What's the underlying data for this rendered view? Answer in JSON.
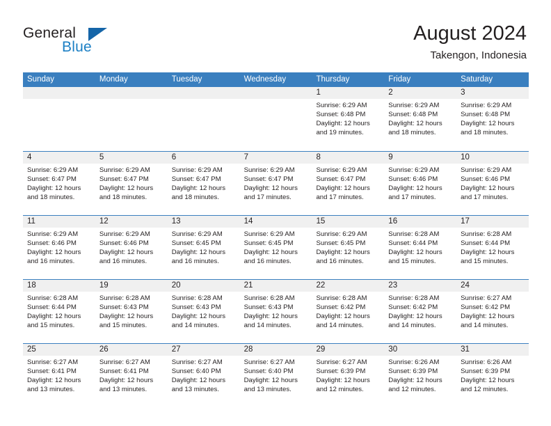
{
  "brand": {
    "name_part1": "General",
    "name_part2": "Blue",
    "triangle_color": "#1565a8",
    "accent_color": "#1b7fc4"
  },
  "header": {
    "title": "August 2024",
    "subtitle": "Takengon, Indonesia",
    "header_bg": "#3a7fbf",
    "date_bar_bg": "#f0f0f0"
  },
  "calendar": {
    "weekdays": [
      "Sunday",
      "Monday",
      "Tuesday",
      "Wednesday",
      "Thursday",
      "Friday",
      "Saturday"
    ],
    "weeks": [
      [
        {
          "day": "",
          "lines": []
        },
        {
          "day": "",
          "lines": []
        },
        {
          "day": "",
          "lines": []
        },
        {
          "day": "",
          "lines": []
        },
        {
          "day": "1",
          "lines": [
            "Sunrise: 6:29 AM",
            "Sunset: 6:48 PM",
            "Daylight: 12 hours",
            "and 19 minutes."
          ]
        },
        {
          "day": "2",
          "lines": [
            "Sunrise: 6:29 AM",
            "Sunset: 6:48 PM",
            "Daylight: 12 hours",
            "and 18 minutes."
          ]
        },
        {
          "day": "3",
          "lines": [
            "Sunrise: 6:29 AM",
            "Sunset: 6:48 PM",
            "Daylight: 12 hours",
            "and 18 minutes."
          ]
        }
      ],
      [
        {
          "day": "4",
          "lines": [
            "Sunrise: 6:29 AM",
            "Sunset: 6:47 PM",
            "Daylight: 12 hours",
            "and 18 minutes."
          ]
        },
        {
          "day": "5",
          "lines": [
            "Sunrise: 6:29 AM",
            "Sunset: 6:47 PM",
            "Daylight: 12 hours",
            "and 18 minutes."
          ]
        },
        {
          "day": "6",
          "lines": [
            "Sunrise: 6:29 AM",
            "Sunset: 6:47 PM",
            "Daylight: 12 hours",
            "and 18 minutes."
          ]
        },
        {
          "day": "7",
          "lines": [
            "Sunrise: 6:29 AM",
            "Sunset: 6:47 PM",
            "Daylight: 12 hours",
            "and 17 minutes."
          ]
        },
        {
          "day": "8",
          "lines": [
            "Sunrise: 6:29 AM",
            "Sunset: 6:47 PM",
            "Daylight: 12 hours",
            "and 17 minutes."
          ]
        },
        {
          "day": "9",
          "lines": [
            "Sunrise: 6:29 AM",
            "Sunset: 6:46 PM",
            "Daylight: 12 hours",
            "and 17 minutes."
          ]
        },
        {
          "day": "10",
          "lines": [
            "Sunrise: 6:29 AM",
            "Sunset: 6:46 PM",
            "Daylight: 12 hours",
            "and 17 minutes."
          ]
        }
      ],
      [
        {
          "day": "11",
          "lines": [
            "Sunrise: 6:29 AM",
            "Sunset: 6:46 PM",
            "Daylight: 12 hours",
            "and 16 minutes."
          ]
        },
        {
          "day": "12",
          "lines": [
            "Sunrise: 6:29 AM",
            "Sunset: 6:46 PM",
            "Daylight: 12 hours",
            "and 16 minutes."
          ]
        },
        {
          "day": "13",
          "lines": [
            "Sunrise: 6:29 AM",
            "Sunset: 6:45 PM",
            "Daylight: 12 hours",
            "and 16 minutes."
          ]
        },
        {
          "day": "14",
          "lines": [
            "Sunrise: 6:29 AM",
            "Sunset: 6:45 PM",
            "Daylight: 12 hours",
            "and 16 minutes."
          ]
        },
        {
          "day": "15",
          "lines": [
            "Sunrise: 6:29 AM",
            "Sunset: 6:45 PM",
            "Daylight: 12 hours",
            "and 16 minutes."
          ]
        },
        {
          "day": "16",
          "lines": [
            "Sunrise: 6:28 AM",
            "Sunset: 6:44 PM",
            "Daylight: 12 hours",
            "and 15 minutes."
          ]
        },
        {
          "day": "17",
          "lines": [
            "Sunrise: 6:28 AM",
            "Sunset: 6:44 PM",
            "Daylight: 12 hours",
            "and 15 minutes."
          ]
        }
      ],
      [
        {
          "day": "18",
          "lines": [
            "Sunrise: 6:28 AM",
            "Sunset: 6:44 PM",
            "Daylight: 12 hours",
            "and 15 minutes."
          ]
        },
        {
          "day": "19",
          "lines": [
            "Sunrise: 6:28 AM",
            "Sunset: 6:43 PM",
            "Daylight: 12 hours",
            "and 15 minutes."
          ]
        },
        {
          "day": "20",
          "lines": [
            "Sunrise: 6:28 AM",
            "Sunset: 6:43 PM",
            "Daylight: 12 hours",
            "and 14 minutes."
          ]
        },
        {
          "day": "21",
          "lines": [
            "Sunrise: 6:28 AM",
            "Sunset: 6:43 PM",
            "Daylight: 12 hours",
            "and 14 minutes."
          ]
        },
        {
          "day": "22",
          "lines": [
            "Sunrise: 6:28 AM",
            "Sunset: 6:42 PM",
            "Daylight: 12 hours",
            "and 14 minutes."
          ]
        },
        {
          "day": "23",
          "lines": [
            "Sunrise: 6:28 AM",
            "Sunset: 6:42 PM",
            "Daylight: 12 hours",
            "and 14 minutes."
          ]
        },
        {
          "day": "24",
          "lines": [
            "Sunrise: 6:27 AM",
            "Sunset: 6:42 PM",
            "Daylight: 12 hours",
            "and 14 minutes."
          ]
        }
      ],
      [
        {
          "day": "25",
          "lines": [
            "Sunrise: 6:27 AM",
            "Sunset: 6:41 PM",
            "Daylight: 12 hours",
            "and 13 minutes."
          ]
        },
        {
          "day": "26",
          "lines": [
            "Sunrise: 6:27 AM",
            "Sunset: 6:41 PM",
            "Daylight: 12 hours",
            "and 13 minutes."
          ]
        },
        {
          "day": "27",
          "lines": [
            "Sunrise: 6:27 AM",
            "Sunset: 6:40 PM",
            "Daylight: 12 hours",
            "and 13 minutes."
          ]
        },
        {
          "day": "28",
          "lines": [
            "Sunrise: 6:27 AM",
            "Sunset: 6:40 PM",
            "Daylight: 12 hours",
            "and 13 minutes."
          ]
        },
        {
          "day": "29",
          "lines": [
            "Sunrise: 6:27 AM",
            "Sunset: 6:39 PM",
            "Daylight: 12 hours",
            "and 12 minutes."
          ]
        },
        {
          "day": "30",
          "lines": [
            "Sunrise: 6:26 AM",
            "Sunset: 6:39 PM",
            "Daylight: 12 hours",
            "and 12 minutes."
          ]
        },
        {
          "day": "31",
          "lines": [
            "Sunrise: 6:26 AM",
            "Sunset: 6:39 PM",
            "Daylight: 12 hours",
            "and 12 minutes."
          ]
        }
      ]
    ]
  }
}
